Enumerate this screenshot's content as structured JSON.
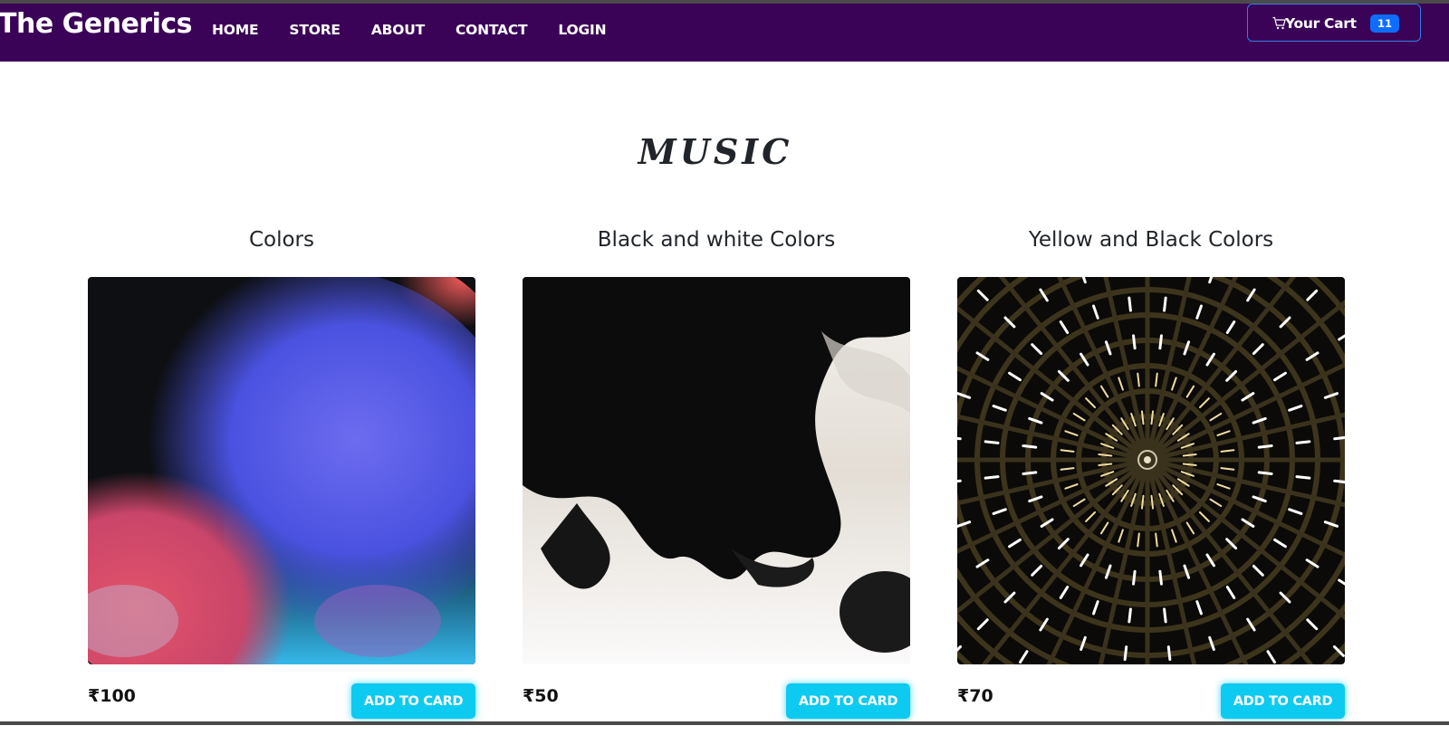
{
  "navbar": {
    "brand": "The Generics",
    "links": [
      "HOME",
      "STORE",
      "ABOUT",
      "CONTACT",
      "LOGIN"
    ],
    "cart_label": "Your Cart",
    "cart_count": "11",
    "background": "#3b0358"
  },
  "section": {
    "title": "MUSIC"
  },
  "products": [
    {
      "title": "Colors",
      "price": "₹100",
      "button": "ADD TO CARD",
      "image": "colorful-smoke-image"
    },
    {
      "title": "Black and white Colors",
      "price": "₹50",
      "button": "ADD TO CARD",
      "image": "black-ink-image"
    },
    {
      "title": "Yellow and Black Colors",
      "price": "₹70",
      "button": "ADD TO CARD",
      "image": "radial-lights-image"
    }
  ],
  "colors": {
    "accent_button": "#0dcaf0",
    "badge": "#0d6efd"
  }
}
